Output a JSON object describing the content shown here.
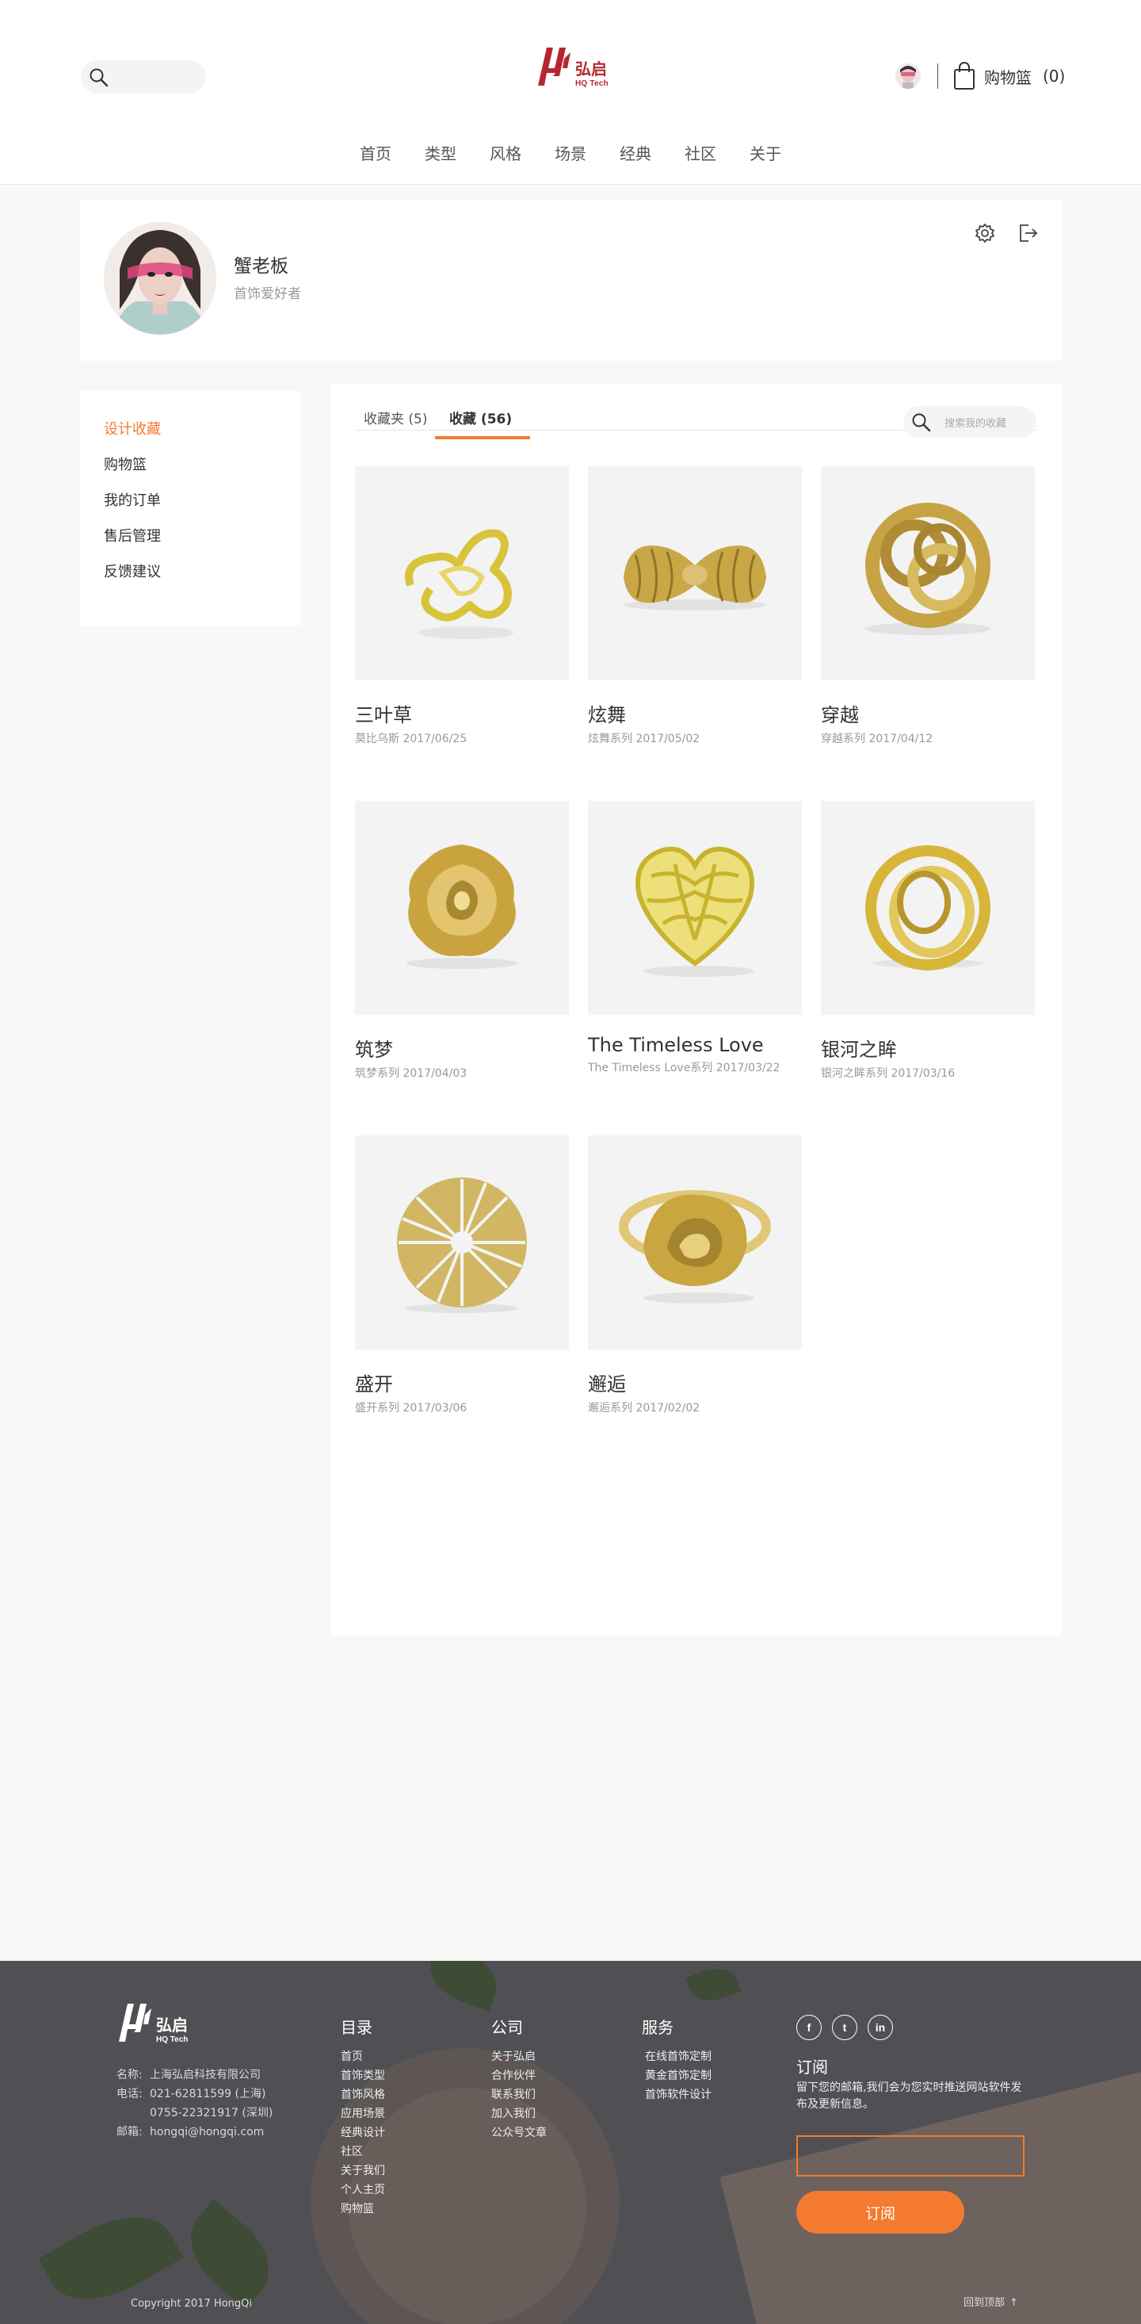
{
  "header": {
    "brand_name": "弘启",
    "brand_sub": "HQ Tech",
    "cart_label": "购物篮",
    "cart_count": "(0)",
    "search_icon": "search-icon",
    "cart_icon": "shopping-bag-icon"
  },
  "nav": [
    "首页",
    "类型",
    "风格",
    "场景",
    "经典",
    "社区",
    "关于"
  ],
  "profile": {
    "name": "蟹老板",
    "title": "首饰爱好者"
  },
  "sidebar": {
    "items": [
      {
        "label": "设计收藏",
        "active": true
      },
      {
        "label": "购物篮"
      },
      {
        "label": "我的订单"
      },
      {
        "label": "售后管理"
      },
      {
        "label": "反馈建议"
      }
    ]
  },
  "tabs": {
    "folders": "收藏夹 (5)",
    "favorites": "收藏 (56)"
  },
  "search": {
    "placeholder": "搜索我的收藏"
  },
  "products": [
    {
      "title": "三叶草",
      "meta": "莫比乌斯   2017/06/25",
      "shape": "trefoil-ring"
    },
    {
      "title": "炫舞",
      "meta": "炫舞系列   2017/05/02",
      "shape": "twisted-band"
    },
    {
      "title": "穿越",
      "meta": "穿越系列   2017/04/12",
      "shape": "knot-ring"
    },
    {
      "title": "筑梦",
      "meta": "筑梦系列   2017/04/03",
      "shape": "wave-flower"
    },
    {
      "title": "The Timeless Love",
      "meta": "The Timeless Love系列   2017/03/22",
      "shape": "lattice-heart"
    },
    {
      "title": "银河之眸",
      "meta": "银河之眸系列   2017/03/16",
      "shape": "double-ring"
    },
    {
      "title": "盛开",
      "meta": "盛开系列   2017/03/06",
      "shape": "radial-disc"
    },
    {
      "title": "邂逅",
      "meta": "邂逅系列   2017/02/02",
      "shape": "twisted-ring"
    }
  ],
  "footer": {
    "company": [
      {
        "k": "名称:",
        "v": "上海弘启科技有限公司"
      },
      {
        "k": "电话:",
        "v": "021-62811599 (上海)"
      },
      {
        "k": "",
        "v": "0755-22321917 (深圳)"
      },
      {
        "k": "邮箱:",
        "v": "hongqi@hongqi.com"
      }
    ],
    "catalog": {
      "title": "目录",
      "links": [
        "首页",
        "首饰类型",
        "首饰风格",
        "应用场景",
        "经典设计",
        "社区",
        "关于我们",
        "个人主页",
        "购物篮"
      ]
    },
    "company_col": {
      "title": "公司",
      "links": [
        "关于弘启",
        "合作伙伴",
        "联系我们",
        "加入我们",
        "公众号文章"
      ]
    },
    "service": {
      "title": "服务",
      "links": [
        "在线首饰定制",
        "黄金首饰定制",
        "首饰软件设计"
      ]
    },
    "socials": [
      "f",
      "t",
      "in"
    ],
    "subscribe_title": "订阅",
    "subscribe_desc": "留下您的邮箱,我们会为您实时推送网站软件发布及更新信息。",
    "subscribe_button": "订阅",
    "copyright": "Copyright 2017 HongQi",
    "back_to_top": "回到顶部",
    "back_to_top_arrow": "↑"
  },
  "colors": {
    "accent": "#f47a30",
    "brand_red": "#b5262f",
    "gold": "#d4ae3c",
    "footer_bg": "#505054"
  }
}
